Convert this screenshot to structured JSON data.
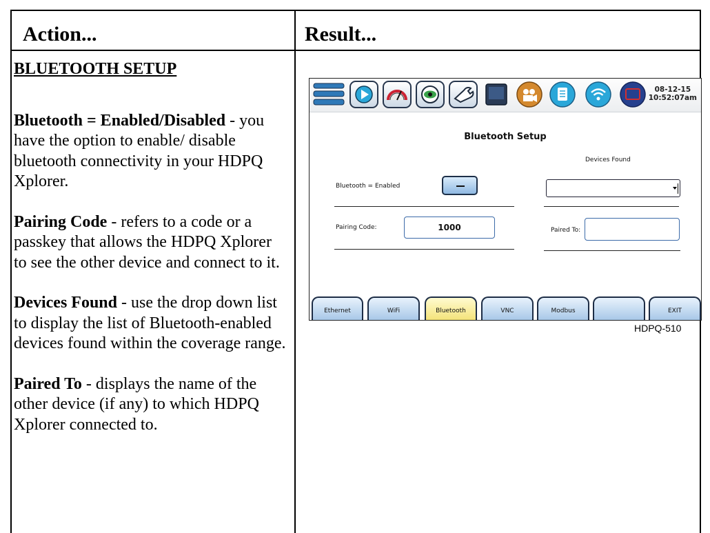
{
  "table": {
    "header_left": "Action...",
    "header_right": "Result..."
  },
  "left": {
    "section_title": "BLUETOOTH SETUP",
    "items": [
      {
        "term": "Bluetooth = Enabled/Disabled",
        "desc": " - you have the option to enable/ disable bluetooth connectivity in your HDPQ Xplorer."
      },
      {
        "term": "Pairing Code",
        "desc": " - refers to a code or a passkey that allows the HDPQ Xplorer to see the other device and connect to it."
      },
      {
        "term": "Devices Found",
        "desc": " - use the drop down list to display the list of Bluetooth-enabled devices found within the coverage range."
      },
      {
        "term": "Paired To",
        "desc": " - displays the name of the other device (if any) to which HDPQ Xplorer connected to."
      }
    ]
  },
  "device": {
    "clock_date": "08-12-15",
    "clock_time": "10:52:07am",
    "toolbar_icons": [
      "menu-icon",
      "play-icon",
      "meter-icon",
      "eye-icon",
      "wrench-icon",
      "monitor-icon",
      "camera-icon",
      "document-icon",
      "wifi-icon",
      "screen-icon"
    ],
    "screen_title": "Bluetooth Setup",
    "bluetooth_label": "Bluetooth = Enabled",
    "devices_found_label": "Devices Found",
    "pairing_code_label": "Pairing Code:",
    "pairing_code_value": "1000",
    "paired_to_label": "Paired To:",
    "paired_to_value": "",
    "tabs": [
      {
        "label": "Ethernet",
        "active": false
      },
      {
        "label": "WiFi",
        "active": false
      },
      {
        "label": "Bluetooth",
        "active": true
      },
      {
        "label": "VNC",
        "active": false
      },
      {
        "label": "Modbus",
        "active": false
      },
      {
        "label": "",
        "active": false
      },
      {
        "label": "EXIT",
        "active": false
      }
    ],
    "colors": {
      "accent_blue": "#2aa7d9",
      "active_tab": "#f4e37a",
      "toolbar_navy": "#27364d"
    }
  },
  "caption": "HDPQ-510"
}
